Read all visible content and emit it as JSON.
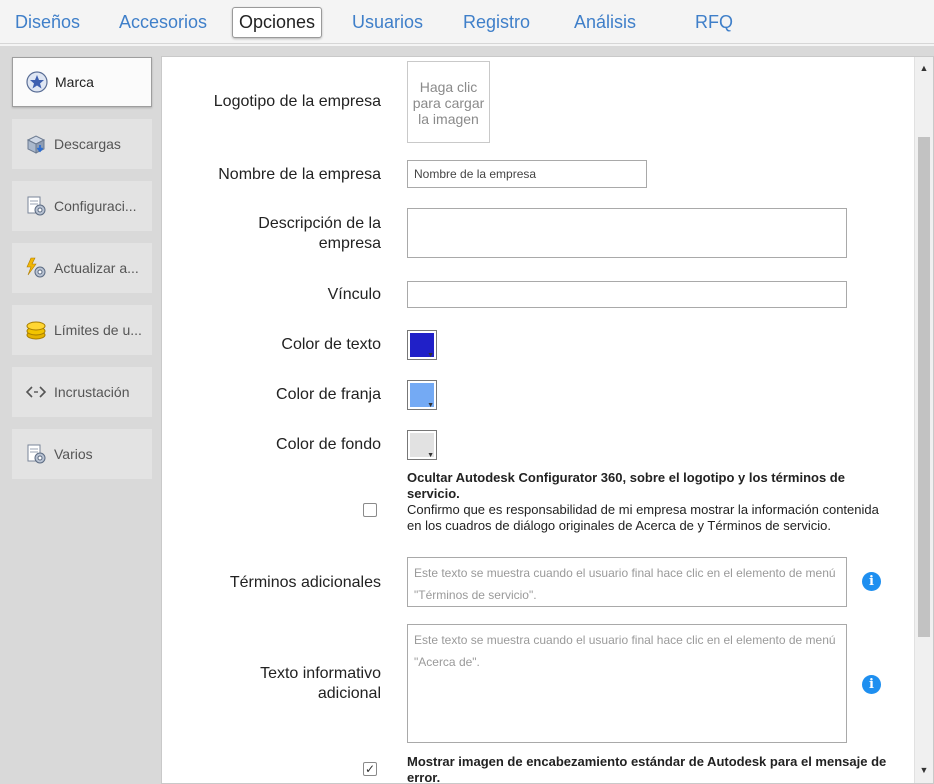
{
  "top_tabs": [
    {
      "label": "Diseños"
    },
    {
      "label": "Accesorios"
    },
    {
      "label": "Opciones",
      "active": true
    },
    {
      "label": "Usuarios"
    },
    {
      "label": "Registro"
    },
    {
      "label": "Análisis"
    },
    {
      "label": "RFQ"
    }
  ],
  "sidebar": {
    "items": [
      {
        "label": "Marca",
        "icon": "star-badge-icon",
        "active": true
      },
      {
        "label": "Descargas",
        "icon": "download-box-icon"
      },
      {
        "label": "Configuraci...",
        "icon": "settings-doc-icon"
      },
      {
        "label": "Actualizar a...",
        "icon": "update-gear-icon"
      },
      {
        "label": "Límites de u...",
        "icon": "coins-icon"
      },
      {
        "label": "Incrustación",
        "icon": "embed-code-icon"
      },
      {
        "label": "Varios",
        "icon": "settings-doc-icon"
      }
    ]
  },
  "form": {
    "logo_label": "Logotipo de la empresa",
    "logo_upload_text": "Haga clic para cargar la imagen",
    "company_name_label": "Nombre de la empresa",
    "company_name_value": "Nombre de la empresa",
    "company_description_label": "Descripción de la empresa",
    "company_description_value": "",
    "link_label": "Vínculo",
    "link_value": "",
    "text_color_label": "Color de texto",
    "band_color_label": "Color de franja",
    "background_color_label": "Color de fondo",
    "hide_branding_title": "Ocultar Autodesk Configurator 360, sobre el logotipo y los términos de servicio.",
    "hide_branding_body": "Confirmo que es responsabilidad de mi empresa mostrar la información contenida en los cuadros de diálogo originales de Acerca de y Términos de servicio.",
    "hide_branding_checked": false,
    "additional_terms_label": "Términos adicionales",
    "additional_terms_placeholder": "Este texto se muestra cuando el usuario final hace clic en el elemento de menú \"Términos de servicio\".",
    "additional_info_label": "Texto informativo adicional",
    "additional_info_placeholder": "Este texto se muestra cuando el usuario final hace clic en el elemento de menú \"Acerca de\".",
    "show_header_image_title": "Mostrar imagen de encabezamiento estándar de Autodesk para el mensaje de error.",
    "show_header_image_checked": true
  },
  "colors": {
    "tab_link": "#3f7fc9",
    "text_color": "#2020c8",
    "band_color": "#74aaf4",
    "background_color": "#e2e2e2",
    "info_icon": "#1e8ff0"
  }
}
